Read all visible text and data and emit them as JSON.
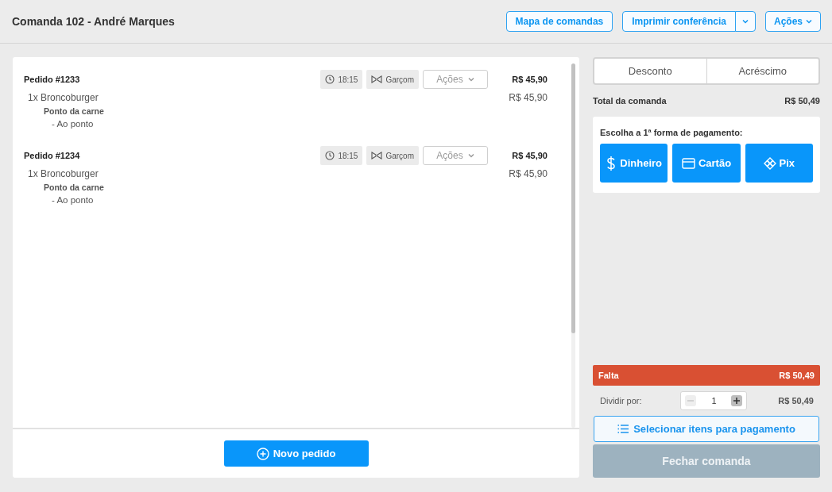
{
  "header": {
    "title": "Comanda 102 - André Marques",
    "buttons": [
      {
        "kind": "plain",
        "label": "Mapa de comandas"
      },
      {
        "kind": "split",
        "label": "Imprimir conferência"
      },
      {
        "kind": "menu",
        "label": "Ações"
      }
    ]
  },
  "orders": [
    {
      "title": "Pedido #1233",
      "time": "18:15",
      "waiter": "Garçom",
      "actions_label": "Ações",
      "total": "R$ 45,90",
      "items": [
        {
          "name": "1x Broncoburger",
          "price": "R$ 45,90",
          "options": [
            {
              "group": "Ponto da carne",
              "choice": "- Ao ponto"
            }
          ]
        }
      ]
    },
    {
      "title": "Pedido #1234",
      "time": "18:15",
      "waiter": "Garçom",
      "actions_label": "Ações",
      "total": "R$ 45,90",
      "items": [
        {
          "name": "1x Broncoburger",
          "price": "R$ 45,90",
          "options": [
            {
              "group": "Ponto da carne",
              "choice": "- Ao ponto"
            }
          ]
        }
      ]
    }
  ],
  "new_order_button": "Novo pedido",
  "adjust_tabs": [
    "Desconto",
    "Acréscimo"
  ],
  "total": {
    "label": "Total da comanda",
    "value": "R$ 50,49"
  },
  "payment": {
    "prompt": "Escolha a 1ª forma de pagamento:",
    "methods": [
      {
        "kind": "cash",
        "label": "Dinheiro"
      },
      {
        "kind": "card",
        "label": "Cartão"
      },
      {
        "kind": "pix",
        "label": "Pix"
      }
    ]
  },
  "remaining": {
    "label": "Falta",
    "value": "R$ 50,49"
  },
  "split": {
    "label": "Dividir por:",
    "value": "1",
    "minus_disabled": true,
    "plus_disabled": false,
    "amount": "R$ 50,49"
  },
  "select_items_button": "Selecionar itens para pagamento",
  "close_button": {
    "label": "Fechar comanda",
    "disabled": true
  }
}
